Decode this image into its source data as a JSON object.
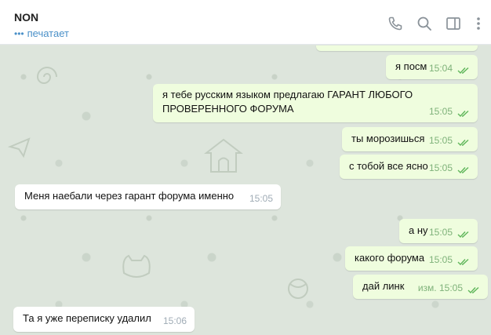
{
  "header": {
    "name": "NON",
    "status": "печатает",
    "status_dots": "•••",
    "icons": [
      "phone-icon",
      "search-icon",
      "sidebar-toggle-icon",
      "more-icon"
    ]
  },
  "colors": {
    "accent": "#4a90c8",
    "outgoing_bubble": "#effdde",
    "incoming_bubble": "#ffffff",
    "read_check": "#5fb65a",
    "chat_background": "#dde5dc"
  },
  "messages": [
    {
      "direction": "out",
      "text": "я посм",
      "time": "15:04",
      "read": true
    },
    {
      "direction": "out",
      "text_lines": [
        "я тебе русским языком предлагаю ГАРАНТ ЛЮБОГО",
        "ПРОВЕРЕННОГО ФОРУМА"
      ],
      "time": "15:05",
      "read": true
    },
    {
      "direction": "out",
      "text": "ты морозишься",
      "time": "15:05",
      "read": true
    },
    {
      "direction": "out",
      "text": "с тобой все ясно",
      "time": "15:05",
      "read": true
    },
    {
      "direction": "in",
      "text": "Меня наебали через гарант форума именно",
      "time": "15:05"
    },
    {
      "direction": "out",
      "text": "а ну",
      "time": "15:05",
      "read": true
    },
    {
      "direction": "out",
      "text": "какого форума",
      "time": "15:05",
      "read": true
    },
    {
      "direction": "out",
      "text": "дай линк",
      "time": "15:05",
      "edited_label": "изм.",
      "read": true
    },
    {
      "direction": "in",
      "text": "Та я уже переписку удалил",
      "time": "15:06"
    }
  ]
}
